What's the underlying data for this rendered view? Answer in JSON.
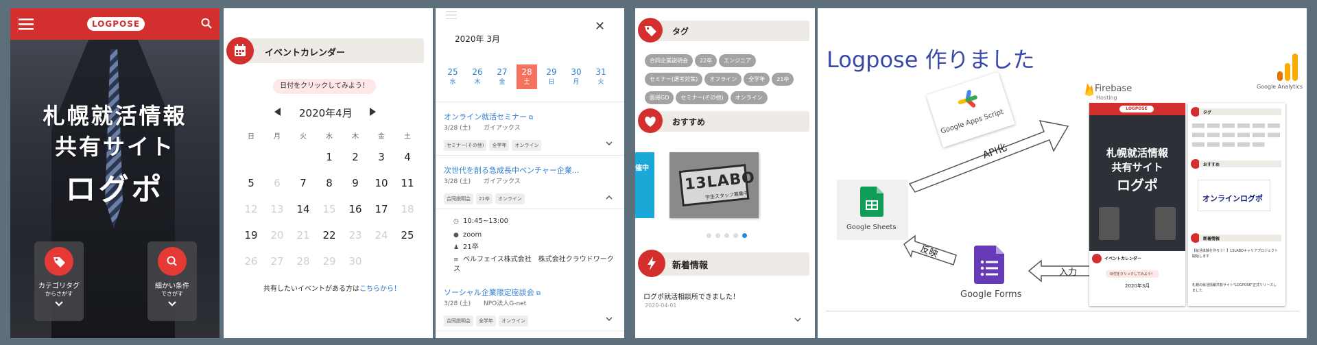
{
  "hero": {
    "logo": "LOGPOSE",
    "title_line1": "札幌就活情報",
    "title_line2": "共有サイト",
    "title_big": "ログポ",
    "card1_label": "カテゴリタグ",
    "card1_sub": "からさがす",
    "card2_label": "細かい条件",
    "card2_sub": "でさがす"
  },
  "calendar": {
    "header": "イベントカレンダー",
    "tip": "日付をクリックしてみよう！",
    "month": "2020年4月",
    "weekdays": [
      "日",
      "月",
      "火",
      "水",
      "木",
      "金",
      "土"
    ],
    "weeks": [
      [
        "",
        "",
        "",
        "1",
        "2",
        "3",
        "4"
      ],
      [
        "5",
        "6",
        "7",
        "8",
        "9",
        "10",
        "11"
      ],
      [
        "12",
        "13",
        "14",
        "15",
        "16",
        "17",
        "18"
      ],
      [
        "19",
        "20",
        "21",
        "22",
        "23",
        "24",
        "25"
      ],
      [
        "26",
        "27",
        "28",
        "29",
        "30",
        "",
        ""
      ]
    ],
    "dim_days": [
      "6",
      "12",
      "13",
      "15",
      "18",
      "20",
      "21",
      "23",
      "24",
      "26",
      "27",
      "28",
      "29",
      "30"
    ],
    "footer_text": "共有したいイベントがある方は",
    "footer_link": "こちらから！"
  },
  "events": {
    "month": "2020年 3月",
    "close": "✕",
    "dates": [
      {
        "n": "25",
        "w": "水"
      },
      {
        "n": "26",
        "w": "木"
      },
      {
        "n": "27",
        "w": "金"
      },
      {
        "n": "28",
        "w": "土",
        "selected": true
      },
      {
        "n": "29",
        "w": "日"
      },
      {
        "n": "30",
        "w": "月"
      },
      {
        "n": "31",
        "w": "火"
      }
    ],
    "items": [
      {
        "title": "オンライン就活セミナー",
        "date": "3/28 (土)",
        "org": "ガイアックス",
        "tags": [
          "セミナー(その他)",
          "全学年",
          "オンライン"
        ]
      },
      {
        "title": "次世代を創る急成長中ベンチャー企業...",
        "date": "3/28 (土)",
        "org": "ガイアックス",
        "tags": [
          "合同説明会",
          "21卒",
          "オンライン"
        ]
      },
      {
        "title": "ソーシャル企業限定座談会",
        "date": "3/28 (土)",
        "org": "NPO法人G-net",
        "tags": [
          "合同説明会",
          "全学年",
          "オンライン"
        ]
      }
    ],
    "detail": {
      "time": "10:45~13:00",
      "place": "zoom",
      "grade": "21卒",
      "companies": "ベルフェイス株式会社　株式会社クラウドワークス"
    }
  },
  "side": {
    "tag_header": "タグ",
    "tags": [
      "合同企業説明会",
      "22卒",
      "エンジニア",
      "セミナー(選考対策)",
      "オフライン",
      "全学年",
      "21卒",
      "面接GD",
      "セミナー(その他)",
      "オンライン"
    ],
    "recommend_header": "おすすめ",
    "banner_left": "催中",
    "banner_brand": "13LABO",
    "banner_sub": "学生スタッフ募集中",
    "news_header": "新着情報",
    "news_title": "ログポ就活相談所できました！",
    "news_date": "2020-04-01"
  },
  "architecture": {
    "title": "Logpose 作りました",
    "apps_script": "Google Apps Script",
    "api_label": "API化",
    "firebase": "Firebase",
    "firebase_sub": "Hosting",
    "analytics": "Google Analytics",
    "sheets": "Google Sheets",
    "forms": "Google Forms",
    "reflect": "反映",
    "input": "入力",
    "mini_logo": "LOGPOSE",
    "mini_title1": "札幌就活情報",
    "mini_title2": "共有サイト",
    "mini_big": "ログポ",
    "mini_tag": "タグ",
    "mini_recommend": "おすすめ",
    "mini_banner": "オンラインログポ",
    "mini_news": "新着情報",
    "mini_news_text": "【就活体験を作ろう！】13LABOキャリアプロジェクト開始します",
    "mini_event": "イベントカレンダー",
    "mini_tip": "日付をクリックしてみよう！",
    "mini_month": "2020年3月",
    "mini_bottom": "札幌の就活情報共有サイト\"LOGPOSE\"正式リリースしました"
  },
  "colors": {
    "brand": "#d32f2f",
    "link": "#2e7dd1",
    "selected": "#f4725f",
    "sheets": "#0f9d58",
    "forms": "#673ab7"
  }
}
